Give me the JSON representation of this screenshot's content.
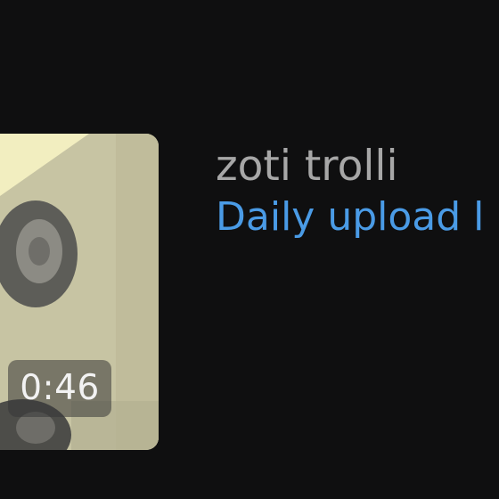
{
  "video": {
    "duration": "0:46",
    "channel_name": "zoti trolli",
    "title": "Daily upload l"
  },
  "colors": {
    "background": "#0f0f10",
    "channel_text": "#a7a7a7",
    "title_link": "#4a9be6",
    "badge_bg": "#373737",
    "thumbnail_bg": "#c9c6a5"
  }
}
